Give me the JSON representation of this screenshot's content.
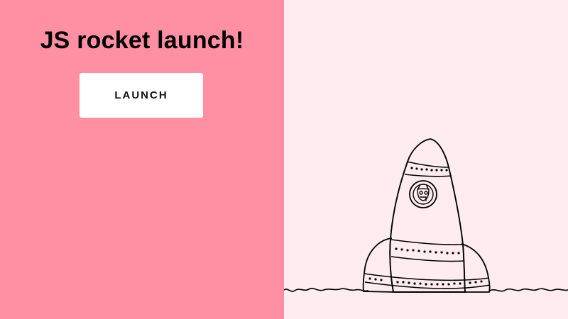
{
  "app": {
    "title": "JS rocket launch!",
    "launch_label": "LAUNCH"
  },
  "colors": {
    "left_background": "#ff8fa3",
    "right_background": "#ffecf1",
    "button_background": "#ffffff",
    "ink": "#000000"
  },
  "scene": {
    "rocket_icon": "hand-drawn-rocket",
    "ground": "hand-drawn-ground-line"
  }
}
